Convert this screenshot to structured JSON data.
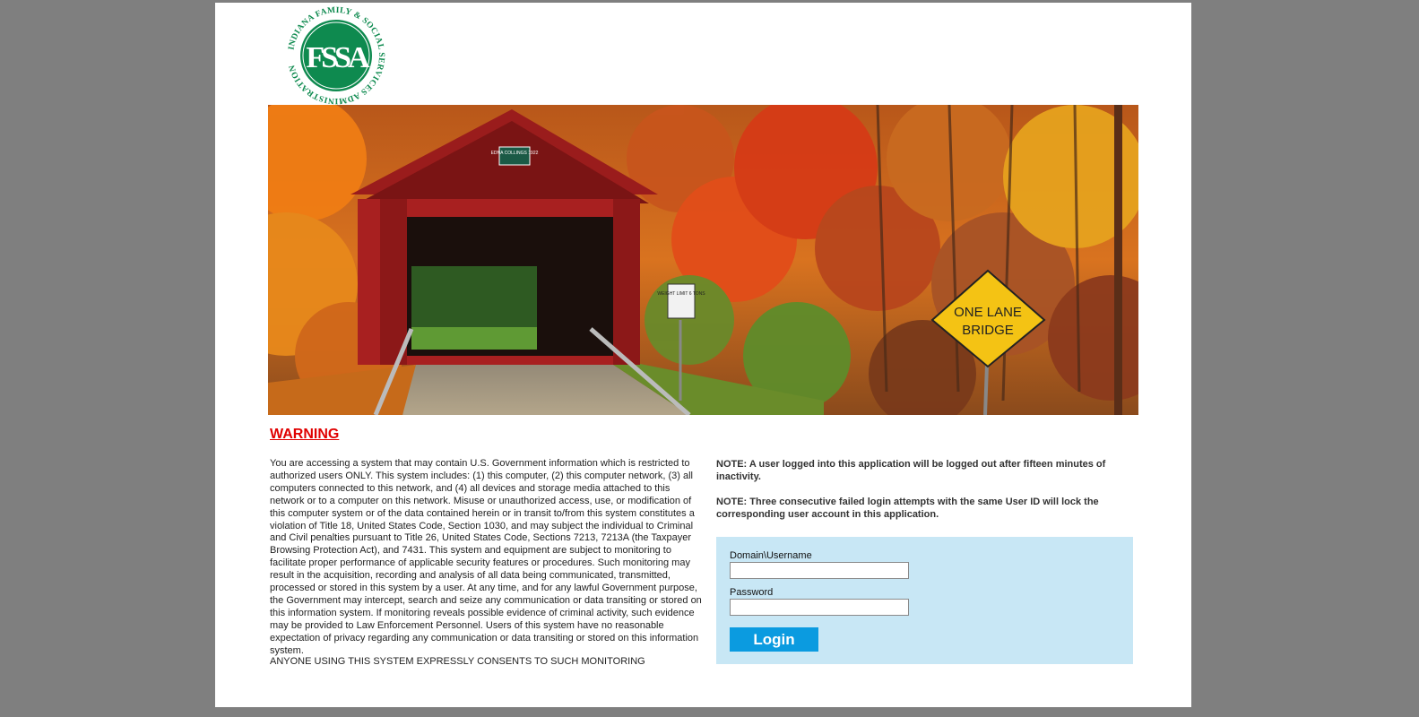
{
  "logo": {
    "letters": "FSSA",
    "ring_text": "INDIANA FAMILY & SOCIAL SERVICES ADMINISTRATION",
    "color": "#0e8a4f"
  },
  "banner": {
    "bridge_sign_text": "EDNA COLLINGS 1922",
    "weight_sign_text": "WEIGHT LIMIT 6 TONS",
    "road_sign_line1": "ONE LANE",
    "road_sign_line2": "BRIDGE"
  },
  "warning": {
    "title": "WARNING",
    "body": "You are accessing a system that may contain U.S. Government information which is restricted to authorized users ONLY. This system includes: (1) this computer, (2) this computer network, (3) all computers connected to this network, and (4) all devices and storage media attached to this network or to a computer on this network. Misuse or unauthorized access, use, or modification of this computer system or of the data contained herein or in transit to/from this system constitutes a violation of Title 18, United States Code, Section 1030, and may subject the individual to Criminal and Civil penalties pursuant to Title 26, United States Code, Sections 7213, 7213A (the Taxpayer Browsing Protection Act), and 7431. This system and equipment are subject to monitoring to facilitate proper performance of applicable security features or procedures. Such monitoring may result in the acquisition, recording and analysis of all data being communicated, transmitted, processed or stored in this system by a user. At any time, and for any lawful Government purpose, the Government may intercept, search and seize any communication or data transiting or stored on this information system. If monitoring reveals possible evidence of criminal activity, such evidence may be provided to Law Enforcement Personnel. Users of this system have no reasonable expectation of privacy regarding any communication or data transiting or stored on this information system.",
    "consent": "ANYONE USING THIS SYSTEM EXPRESSLY CONSENTS TO SUCH MONITORING"
  },
  "notes": [
    "NOTE: A user logged into this application will be logged out after fifteen minutes of inactivity.",
    "NOTE: Three consecutive failed login attempts with the same User ID will lock the corresponding user account in this application."
  ],
  "login": {
    "username_label": "Domain\\Username",
    "username_value": "",
    "password_label": "Password",
    "password_value": "",
    "button_label": "Login",
    "button_color": "#0b9be0",
    "panel_color": "#c8e7f5"
  },
  "colors": {
    "warning": "#e00000",
    "background": "#7f7f7f"
  }
}
